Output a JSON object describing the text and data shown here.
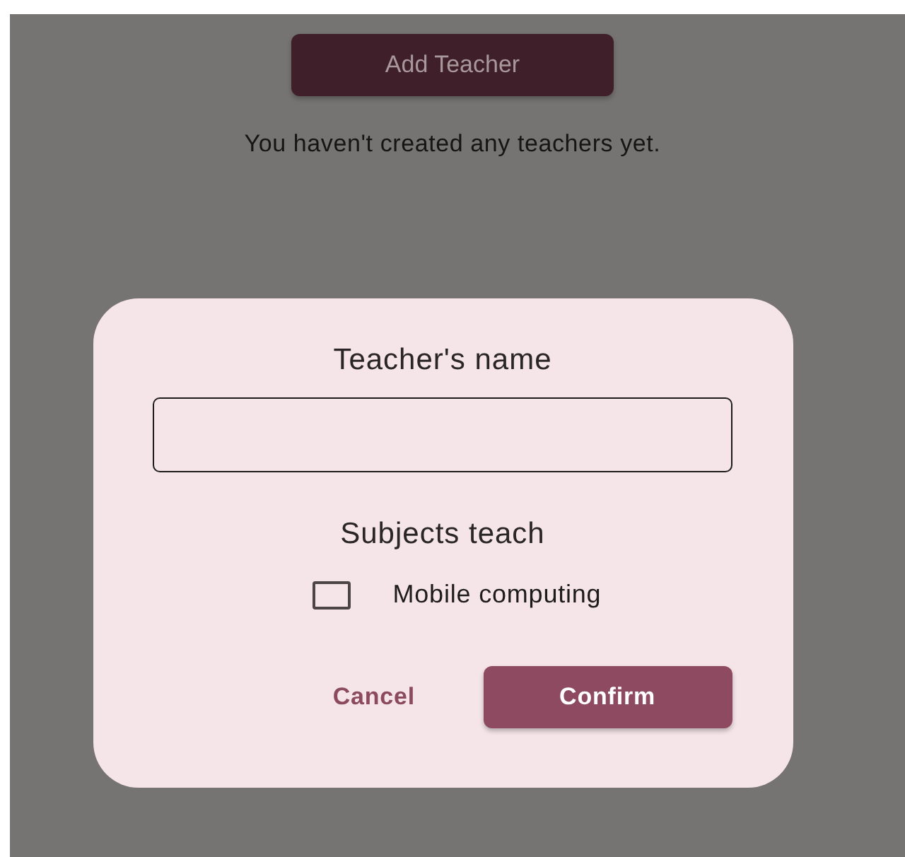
{
  "screen": {
    "add_button": "Add Teacher",
    "empty_message": "You haven't created any teachers yet."
  },
  "dialog": {
    "title": "Teacher's name",
    "subjects_label": "Subjects teach",
    "subjects": [
      {
        "label": "Mobile computing",
        "checked": false
      }
    ],
    "buttons": [
      {
        "label": "Cancel",
        "kind": "text"
      },
      {
        "label": "Confirm",
        "kind": "filled"
      }
    ]
  }
}
